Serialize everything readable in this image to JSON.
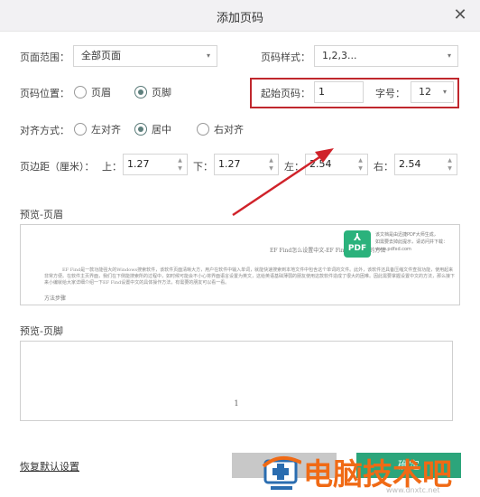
{
  "dialog": {
    "title": "添加页码",
    "close_icon": "close-icon"
  },
  "page_range": {
    "label": "页面范围：",
    "value": "全部页面"
  },
  "page_style": {
    "label": "页码样式：",
    "value": "1,2,3..."
  },
  "position": {
    "label": "页码位置：",
    "options": [
      {
        "label": "页眉",
        "selected": false
      },
      {
        "label": "页脚",
        "selected": true
      }
    ]
  },
  "start_page": {
    "label": "起始页码：",
    "value": "1"
  },
  "font_size": {
    "label": "字号：",
    "value": "12"
  },
  "alignment": {
    "label": "对齐方式：",
    "options": [
      {
        "label": "左对齐",
        "selected": false
      },
      {
        "label": "居中",
        "selected": true
      },
      {
        "label": "右对齐",
        "selected": false
      }
    ]
  },
  "margins": {
    "label": "页边距（厘米）：",
    "top_label": "上：",
    "top_value": "1.27",
    "bottom_label": "下：",
    "bottom_value": "1.27",
    "left_label": "左：",
    "left_value": "2.54",
    "right_label": "右：",
    "right_value": "2.54"
  },
  "preview_header": {
    "title": "预览-页眉",
    "header_text": "EF Find怎么设置中文-EF Find设置中文的方法",
    "paragraph": "EF Find是一款功能强大的Windows搜索软件，该软件页面清晰大方，用户在软件中输入单词，就能快速搜索到本地文件中包含这个单词的文件。此外，该软件还具备压缩文件查找功能，使用起来非常方便。在软件主页界面，我们在下侧能搜索所的过程中，如时候可能会不小心将界面语言设置为英文，这给英语基础薄弱的朋友使用这款软件造成了很大的困难。因此需要掌握设置中文的方法，那么接下来小编就给大家详细介绍一下EF Find设置中文的具体操作方法，有需要的朋友可以看一看。",
    "step_text": "方法步骤",
    "pdf_badge": "PDF",
    "pdf_note_line1": "该文档是由迅捷PDF大师生成，",
    "pdf_note_line2": "如需要去掉此提示，请访问并下载：",
    "pdf_note_line3": "www.pdfxd.com"
  },
  "preview_footer": {
    "title": "预览-页脚",
    "page_number": "1"
  },
  "footer": {
    "reset_label": "恢复默认设置",
    "cancel_label": "取消",
    "ok_label": "确定"
  },
  "watermark": {
    "text": "电脑技术吧",
    "url": "www.dnxtc.net"
  },
  "colors": {
    "highlight": "#c0272d",
    "ok_button": "#2ca57b",
    "pdf_badge": "#2bb27c",
    "watermark": "#f06a15"
  }
}
